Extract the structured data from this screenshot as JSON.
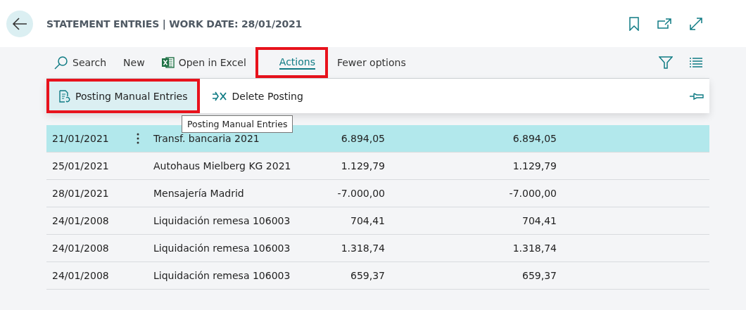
{
  "page": {
    "title": "STATEMENT ENTRIES | WORK DATE: 28/01/2021"
  },
  "toolbar": [
    {
      "kind": "search",
      "label": "Search",
      "expanded": false,
      "highlighted": false
    },
    {
      "kind": "plain",
      "label": "New",
      "expanded": false,
      "highlighted": false
    },
    {
      "kind": "excel",
      "label": "Open in Excel",
      "expanded": false,
      "highlighted": false
    },
    {
      "kind": "menu",
      "label": "Actions",
      "expanded": true,
      "highlighted": true
    },
    {
      "kind": "plain",
      "label": "Fewer options",
      "expanded": false,
      "highlighted": false
    }
  ],
  "actions": [
    {
      "kind": "post",
      "label": "Posting Manual Entries",
      "hovered": true,
      "highlighted": true
    },
    {
      "kind": "delete",
      "label": "Delete Posting",
      "hovered": false,
      "highlighted": false
    }
  ],
  "tooltip": "Posting Manual Entries",
  "rows": [
    {
      "date": "21/01/2021",
      "description": "Transf. bancaria 2021",
      "amount": "6.894,05",
      "amount_2": "6.894,05",
      "selected": true
    },
    {
      "date": "25/01/2021",
      "description": "Autohaus Mielberg KG 2021",
      "amount": "1.129,79",
      "amount_2": "1.129,79",
      "selected": false
    },
    {
      "date": "28/01/2021",
      "description": "Mensajería Madrid",
      "amount": "-7.000,00",
      "amount_2": "-7.000,00",
      "selected": false
    },
    {
      "date": "24/01/2008",
      "description": "Liquidación remesa 106003",
      "amount": "704,41",
      "amount_2": "704,41",
      "selected": false
    },
    {
      "date": "24/01/2008",
      "description": "Liquidación remesa 106003",
      "amount": "1.318,74",
      "amount_2": "1.318,74",
      "selected": false
    },
    {
      "date": "24/01/2008",
      "description": "Liquidación remesa 106003",
      "amount": "659,37",
      "amount_2": "659,37",
      "selected": false
    }
  ]
}
